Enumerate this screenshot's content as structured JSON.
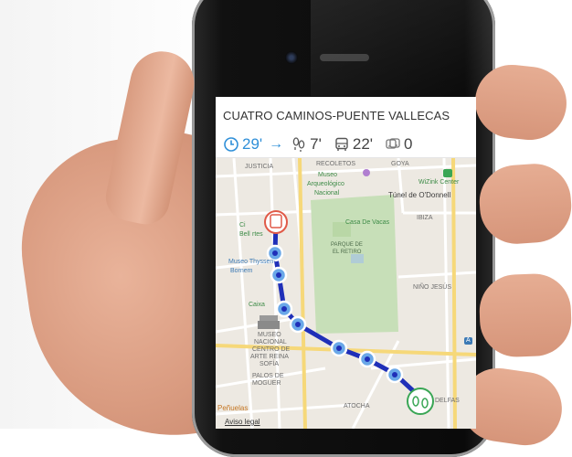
{
  "route": {
    "title": "CUATRO CAMINOS-PUENTE VALLECAS",
    "total_time": "29'",
    "walk_time": "7'",
    "bus_time": "22'",
    "transfers": "0"
  },
  "map": {
    "labels": {
      "justicia": "JUSTICIA",
      "recoletos": "RECOLETOS",
      "goya": "GOYA",
      "museo_arq_1": "Museo",
      "museo_arq_2": "Arqueológico",
      "museo_arq_3": "Nacional",
      "wizink": "WiZink Center",
      "tunel": "Túnel de O'Donnell",
      "ibiza": "IBIZA",
      "casa_vacas": "Casa De Vacas",
      "cibeles_1": "Ci",
      "cibeles_2": "Bell",
      "cibeles_3": "rtes",
      "parque_1": "PARQUE DE",
      "parque_2": "EL RETIRO",
      "thyssen_1": "Museo Thyssen-",
      "thyssen_2": "Bornem",
      "nino_jesus": "NIÑO JESÚS",
      "caixa": "Caixa",
      "reina_1": "MUSEO",
      "reina_2": "NACIONAL",
      "reina_3": "CENTRO DE",
      "reina_4": "ARTE REINA",
      "reina_5": "SOFÍA",
      "palos_1": "PALOS DE",
      "palos_2": "MOGUER",
      "atocha": "ATOCHA",
      "delfas": "DELFAS",
      "penuelas": "Peñuelas",
      "aviso": "Aviso legal",
      "a_badge": "A"
    }
  },
  "colors": {
    "accent": "#2f8fd8",
    "route_line": "#1f2fb8",
    "park": "#c7dfb8",
    "start_marker": "#e05a48",
    "end_marker": "#3aa655"
  }
}
